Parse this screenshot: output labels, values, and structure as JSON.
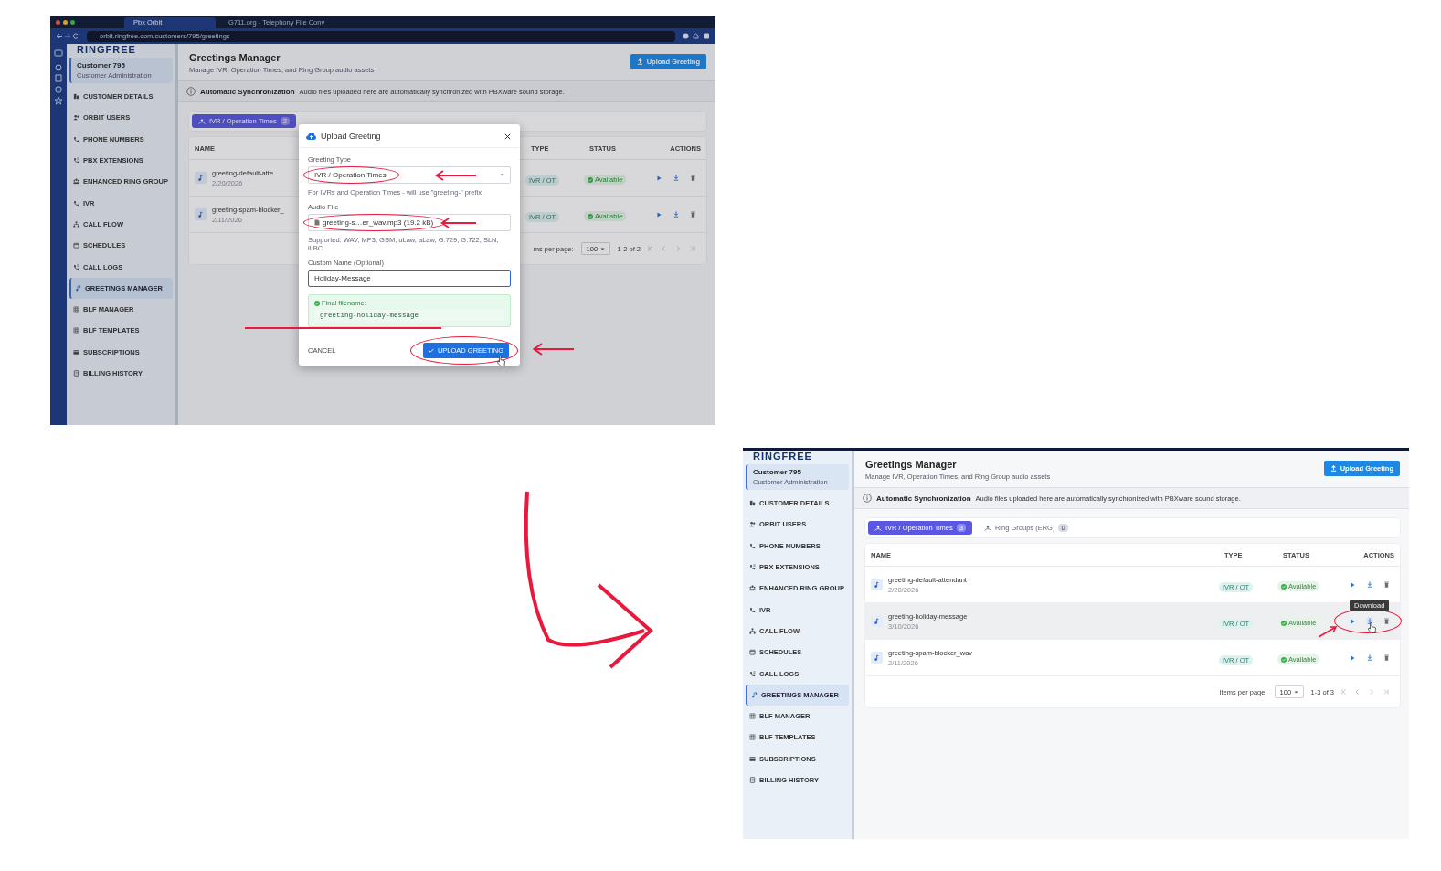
{
  "screenshots": [
    {
      "browser": {
        "tabs": [
          {
            "label": "Pbx Orbit",
            "selected": true
          },
          {
            "label": "G711.org - Telephony File Conv",
            "selected": false
          }
        ],
        "url": "orbit.ringfree.com/customers/795/greetings"
      },
      "logo": "RINGFREE",
      "customer": {
        "name": "Customer 795",
        "role": "Customer Administration"
      },
      "nav": [
        {
          "label": "CUSTOMER DETAILS",
          "selected": false
        },
        {
          "label": "ORBIT USERS",
          "selected": false
        },
        {
          "label": "PHONE NUMBERS",
          "selected": false
        },
        {
          "label": "PBX EXTENSIONS",
          "selected": false
        },
        {
          "label": "ENHANCED RING GROUP",
          "selected": false
        },
        {
          "label": "IVR",
          "selected": false
        },
        {
          "label": "CALL FLOW",
          "selected": false
        },
        {
          "label": "SCHEDULES",
          "selected": false
        },
        {
          "label": "CALL LOGS",
          "selected": false
        },
        {
          "label": "GREETINGS MANAGER",
          "selected": true
        },
        {
          "label": "BLF MANAGER",
          "selected": false
        },
        {
          "label": "BLF TEMPLATES",
          "selected": false
        },
        {
          "label": "SUBSCRIPTIONS",
          "selected": false
        },
        {
          "label": "BILLING HISTORY",
          "selected": false
        }
      ],
      "header": {
        "title": "Greetings Manager",
        "subtitle": "Manage IVR, Operation Times, and Ring Group audio assets",
        "button": "Upload Greeting"
      },
      "banner": {
        "title": "Automatic Synchronization",
        "text": "Audio files uploaded here are automatically synchronized with PBXware sound storage."
      },
      "tabs": [
        {
          "label": "IVR / Operation Times",
          "count": "2",
          "selected": true
        }
      ],
      "table": {
        "columns": [
          "NAME",
          "TYPE",
          "STATUS",
          "ACTIONS"
        ],
        "rows": [
          {
            "name": "greeting-default-atte",
            "date": "2/20/2026",
            "type": "IVR / OT",
            "status": "Available",
            "hovered": false
          },
          {
            "name": "greeting-spam-blocker_",
            "date": "2/11/2026",
            "type": "IVR / OT",
            "status": "Available",
            "hovered": false
          }
        ]
      },
      "pagination": {
        "per_page_label": "ms per page:",
        "per_page": "100",
        "range": "1-2 of 2"
      },
      "dialog": {
        "title": "Upload Greeting",
        "type_label": "Greeting Type",
        "type_value": "IVR / Operation Times",
        "type_hint": "For IVRs and Operation Times - will use \"greeting-\" prefix",
        "file_label": "Audio File",
        "file_value": "greeting-s…er_wav.mp3 (19.2 kB)",
        "file_hint": "Supported: WAV, MP3, GSM, uLaw, aLaw, G.729, G.722, SLN, iLBC",
        "name_label": "Custom Name (Optional)",
        "name_value": "Holiday-Message",
        "final_label": "Final filename:",
        "final_value": "greeting-holiday-message",
        "cancel": "CANCEL",
        "submit": "UPLOAD GREETING"
      }
    },
    {
      "logo": "RINGFREE",
      "customer": {
        "name": "Customer 795",
        "role": "Customer Administration"
      },
      "nav": [
        {
          "label": "CUSTOMER DETAILS",
          "selected": false
        },
        {
          "label": "ORBIT USERS",
          "selected": false
        },
        {
          "label": "PHONE NUMBERS",
          "selected": false
        },
        {
          "label": "PBX EXTENSIONS",
          "selected": false
        },
        {
          "label": "ENHANCED RING GROUP",
          "selected": false
        },
        {
          "label": "IVR",
          "selected": false
        },
        {
          "label": "CALL FLOW",
          "selected": false
        },
        {
          "label": "SCHEDULES",
          "selected": false
        },
        {
          "label": "CALL LOGS",
          "selected": false
        },
        {
          "label": "GREETINGS MANAGER",
          "selected": true
        },
        {
          "label": "BLF MANAGER",
          "selected": false
        },
        {
          "label": "BLF TEMPLATES",
          "selected": false
        },
        {
          "label": "SUBSCRIPTIONS",
          "selected": false
        },
        {
          "label": "BILLING HISTORY",
          "selected": false
        }
      ],
      "header": {
        "title": "Greetings Manager",
        "subtitle": "Manage IVR, Operation Times, and Ring Group audio assets",
        "button": "Upload Greeting"
      },
      "banner": {
        "title": "Automatic Synchronization",
        "text": "Audio files uploaded here are automatically synchronized with PBXware sound storage."
      },
      "tabs": [
        {
          "label": "IVR / Operation Times",
          "count": "3",
          "selected": true
        },
        {
          "label": "Ring Groups (ERG)",
          "count": "0",
          "selected": false
        }
      ],
      "table": {
        "columns": [
          "NAME",
          "TYPE",
          "STATUS",
          "ACTIONS"
        ],
        "rows": [
          {
            "name": "greeting-default-attendant",
            "date": "2/20/2026",
            "type": "IVR / OT",
            "status": "Available",
            "hovered": false
          },
          {
            "name": "greeting-holiday-message",
            "date": "3/10/2026",
            "type": "IVR / OT",
            "status": "Available",
            "hovered": true
          },
          {
            "name": "greeting-spam-blocker_wav",
            "date": "2/11/2026",
            "type": "IVR / OT",
            "status": "Available",
            "hovered": false
          }
        ]
      },
      "tooltip": "Download",
      "pagination": {
        "per_page_label": "Items per page:",
        "per_page": "100",
        "range": "1-3 of 3"
      }
    }
  ]
}
